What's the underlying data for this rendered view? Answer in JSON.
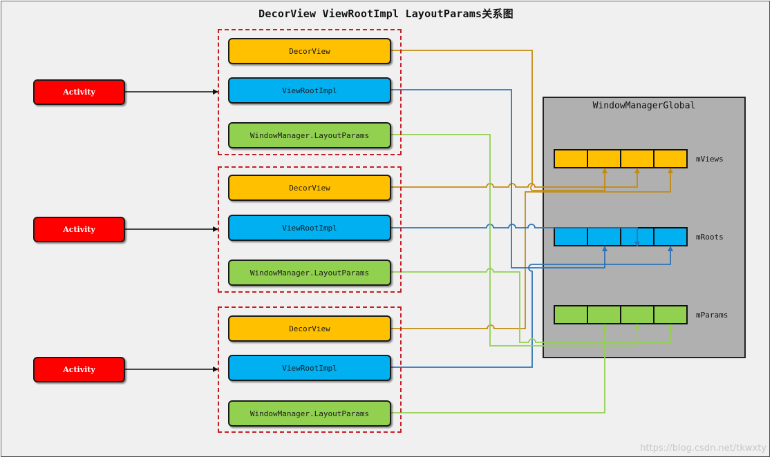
{
  "title": "DecorView ViewRootImpl LayoutParams关系图",
  "labels": {
    "activity": "Activity",
    "decor_view": "DecorView",
    "view_root_impl": "ViewRootImpl",
    "layout_params": "WindowManager.LayoutParams",
    "window_manager_global": "WindowManagerGlobal",
    "m_views": "mViews",
    "m_roots": "mRoots",
    "m_params": "mParams"
  },
  "colors": {
    "decor_view": "#ffc000",
    "view_root_impl": "#00b0f0",
    "layout_params": "#92d050",
    "activity": "#ff0000",
    "group_border": "#c41e25",
    "decor_line": "#c58a0f",
    "vri_line": "#2e74b5",
    "lp_line": "#92d050",
    "global_bg": "#b0b0b0"
  },
  "watermark": "https://blog.csdn.net/tkwxty"
}
